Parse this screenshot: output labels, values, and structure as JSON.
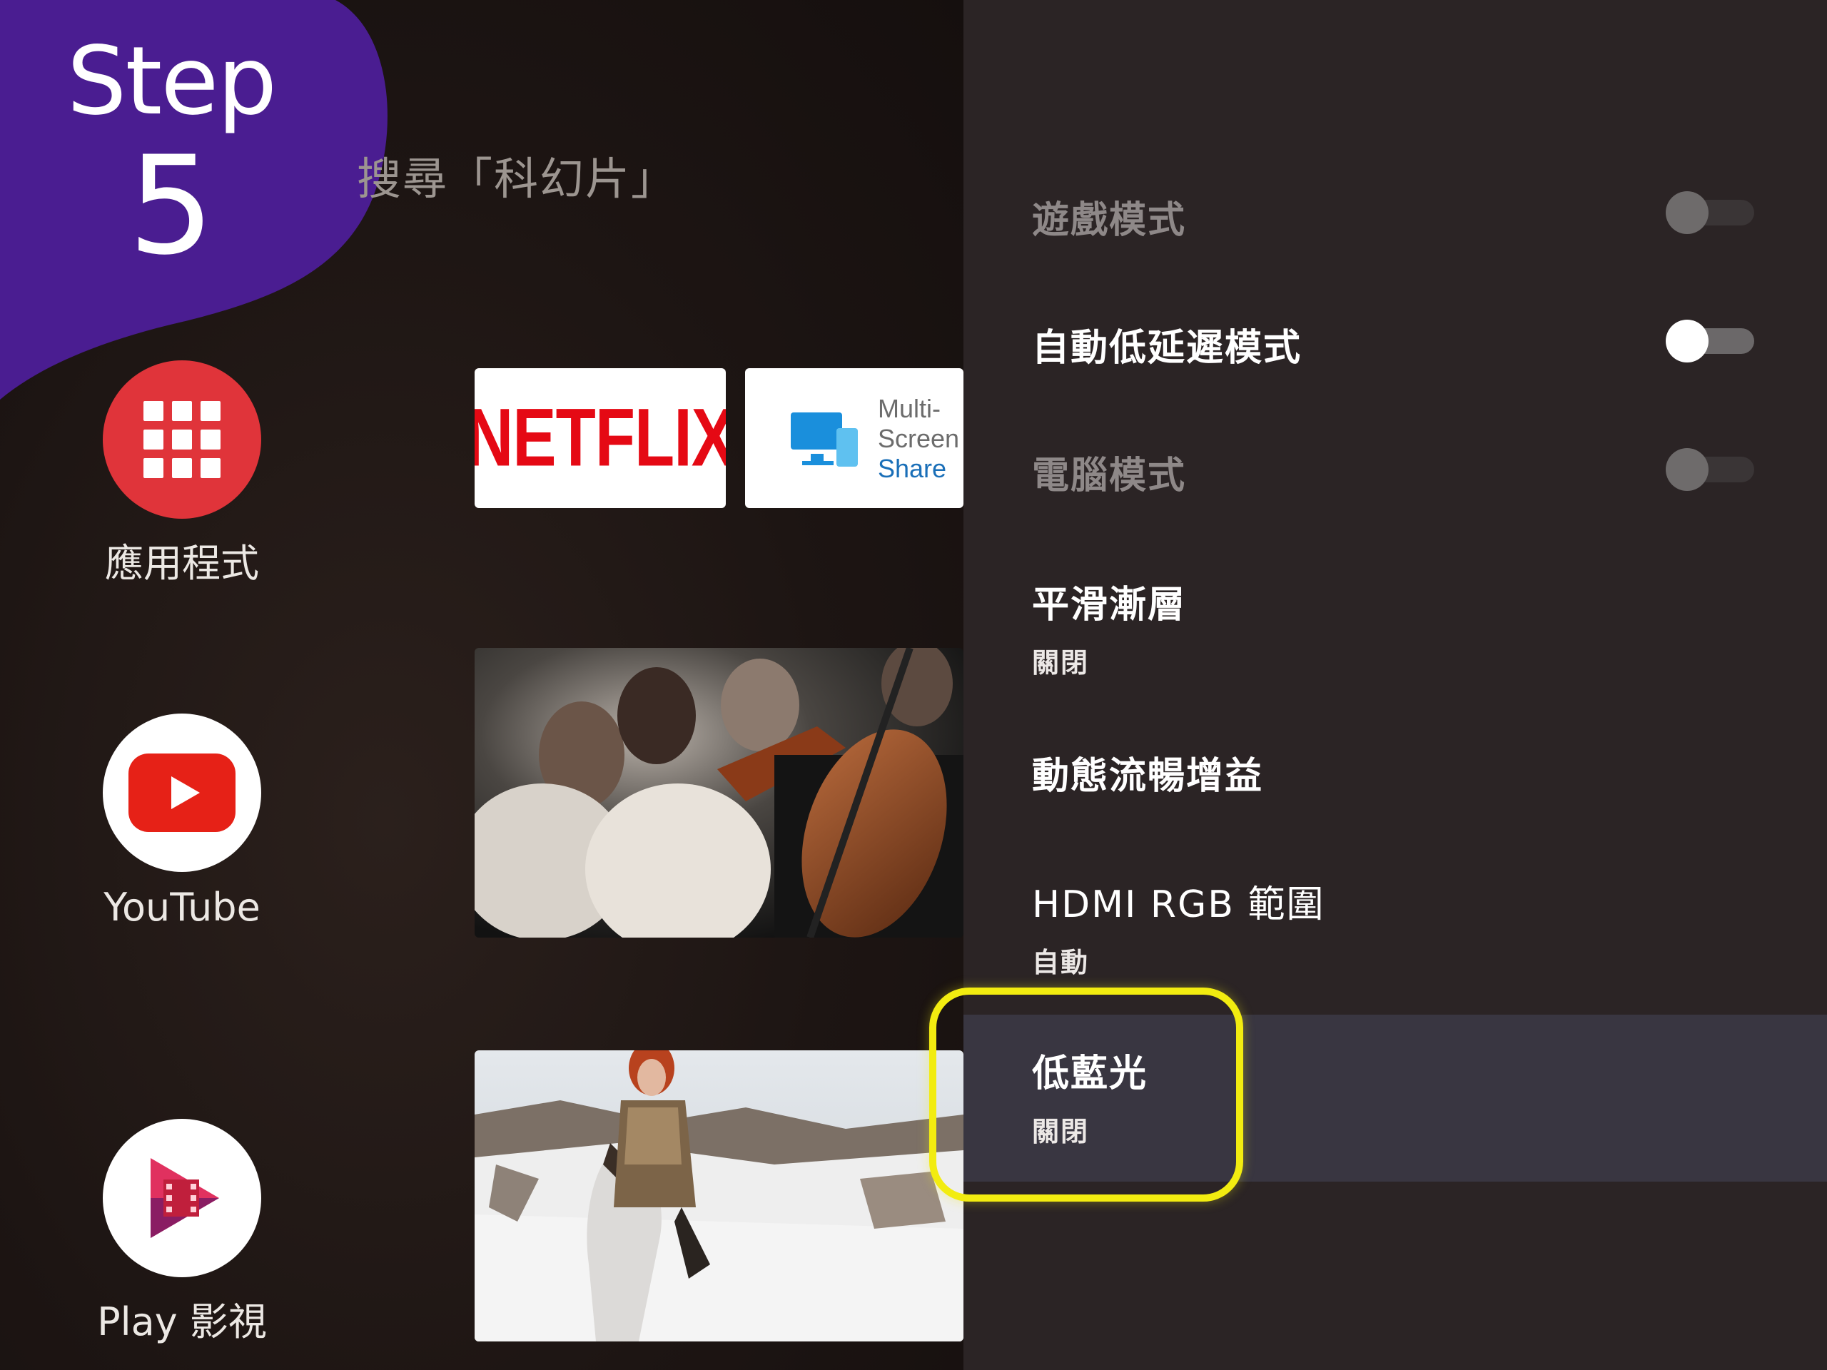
{
  "step": {
    "word": "Step",
    "number": "5",
    "color": "#4a1d91"
  },
  "search_hint": "搜尋「科幻片」",
  "apps": [
    {
      "label": "應用程式",
      "icon": "apps-grid-icon",
      "color": "#e0343a"
    },
    {
      "label": "YouTube",
      "icon": "youtube-play-icon",
      "color": "#e62117"
    },
    {
      "label": "Play 影視",
      "icon": "play-movies-icon",
      "color": "#e0315f"
    }
  ],
  "tiles": {
    "netflix": "NETFLIX",
    "multiscreen": {
      "line1": "Multi-",
      "line2": "Screen",
      "line3": "Share"
    }
  },
  "settings": [
    {
      "title": "遊戲模式",
      "toggle": false,
      "enabled": false
    },
    {
      "title": "自動低延遲模式",
      "toggle": false,
      "enabled": true
    },
    {
      "title": "電腦模式",
      "toggle": false,
      "enabled": false
    },
    {
      "title": "平滑漸層",
      "value": "關閉"
    },
    {
      "title": "動態流暢增益"
    },
    {
      "title": "HDMI RGB 範圍",
      "value": "自動"
    },
    {
      "title": "低藍光",
      "value": "關閉",
      "selected": true
    }
  ],
  "colors": {
    "panel": "#2b2425",
    "selected_row": "#393641",
    "highlight": "#f2ec10"
  }
}
